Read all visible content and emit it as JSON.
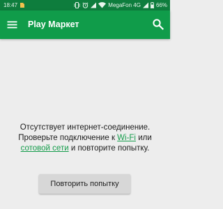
{
  "status_bar": {
    "time": "18:47",
    "carrier": "MegaFon 4G",
    "battery": "66%",
    "icons": [
      "notification-icon",
      "vibrate-icon",
      "alarm-icon",
      "signal-icon",
      "wifi-icon",
      "cellular-signal-icon",
      "battery-icon"
    ]
  },
  "app_bar": {
    "title": "Play Маркет",
    "icons": [
      "hamburger-menu-icon",
      "search-icon"
    ],
    "color": "#109c4a",
    "status_color": "#0e7d3d"
  },
  "message": {
    "text_before": "Отсутствует интернет-соединение. Проверьте подключение к ",
    "wifi_link": "Wi-Fi",
    "text_middle": " или ",
    "mobile_link": "сотовой сети",
    "text_after": " и повторите попытку.",
    "link_color": "#139c4a"
  },
  "retry_button": {
    "label": "Повторить попытку"
  }
}
